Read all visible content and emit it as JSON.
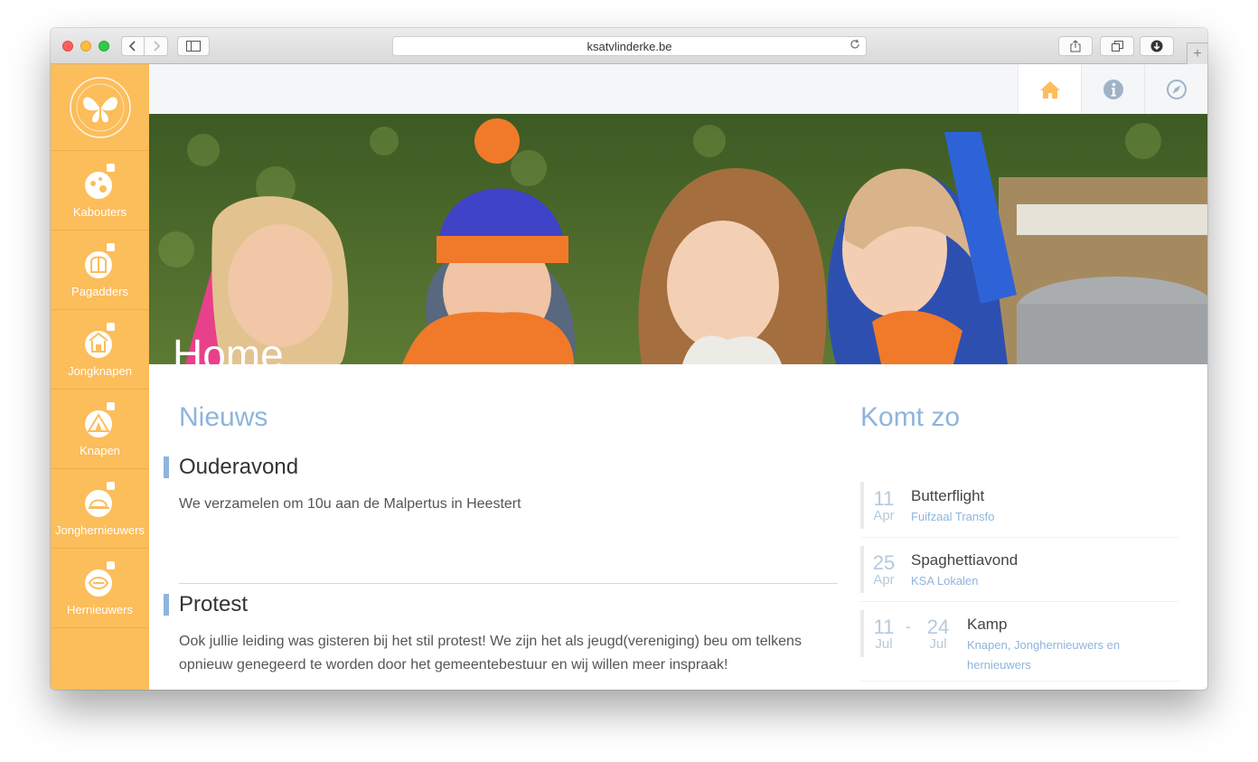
{
  "browser": {
    "url": "ksatvlinderke.be"
  },
  "sidebar": {
    "items": [
      {
        "label": "Kabouters"
      },
      {
        "label": "Pagadders"
      },
      {
        "label": "Jongknapen"
      },
      {
        "label": "Knapen"
      },
      {
        "label": "Jonghernieuwers"
      },
      {
        "label": "Hernieuwers"
      }
    ]
  },
  "hero": {
    "title": "Home"
  },
  "news": {
    "heading": "Nieuws",
    "posts": [
      {
        "title": "Ouderavond",
        "body": "We verzamelen om 10u aan de Malpertus in Heestert"
      },
      {
        "title": "Protest",
        "body": "Ook jullie leiding was gisteren bij het stil protest! We zijn het als jeugd(vereniging) beu om telkens opnieuw genegeerd te worden door het gemeentebestuur en wij willen meer inspraak!"
      }
    ]
  },
  "upcoming": {
    "heading": "Komt zo",
    "events": [
      {
        "day": "11",
        "month": "Apr",
        "name": "Butterflight",
        "location": "Fuifzaal Transfo"
      },
      {
        "day": "25",
        "month": "Apr",
        "name": "Spaghettiavond",
        "location": "KSA Lokalen"
      },
      {
        "day": "11",
        "month": "Jul",
        "end_day": "24",
        "end_month": "Jul",
        "dash": "-",
        "name": "Kamp",
        "location": "Knapen, Jonghernieuwers en hernieuwers"
      }
    ]
  },
  "colors": {
    "sidebar": "#fcbd5b",
    "accent": "#8fb4dd",
    "home_icon": "#fcbd5b",
    "nav_icon": "#9fb3c8"
  }
}
